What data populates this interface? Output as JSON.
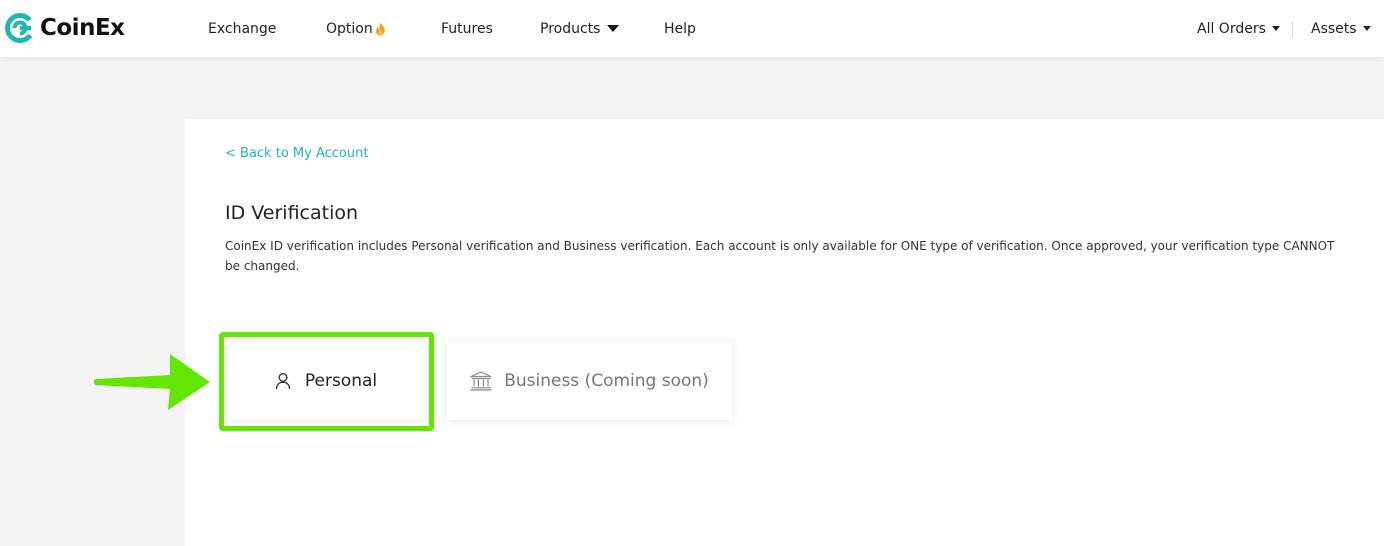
{
  "brand": {
    "name": "CoinEx",
    "accent_color": "#21b6b6",
    "logo_icon": "coinex-logo-icon"
  },
  "nav": {
    "exchange": "Exchange",
    "option": "Option",
    "option_badge_icon": "fire-icon",
    "futures": "Futures",
    "products": "Products",
    "help": "Help",
    "all_orders": "All Orders",
    "assets": "Assets"
  },
  "page": {
    "back_link": "< Back to My Account",
    "title": "ID Verification",
    "description": "CoinEx ID verification includes Personal verification and Business verification. Each account is only available for ONE type of verification. Once approved, your verification type CANNOT be changed."
  },
  "verification_types": {
    "personal": {
      "label": "Personal",
      "icon": "user-icon"
    },
    "business": {
      "label": "Business (Coming soon)",
      "icon": "bank-icon"
    }
  },
  "annotation": {
    "highlight_color": "#63e600",
    "arrow_icon": "arrow-right-icon"
  }
}
